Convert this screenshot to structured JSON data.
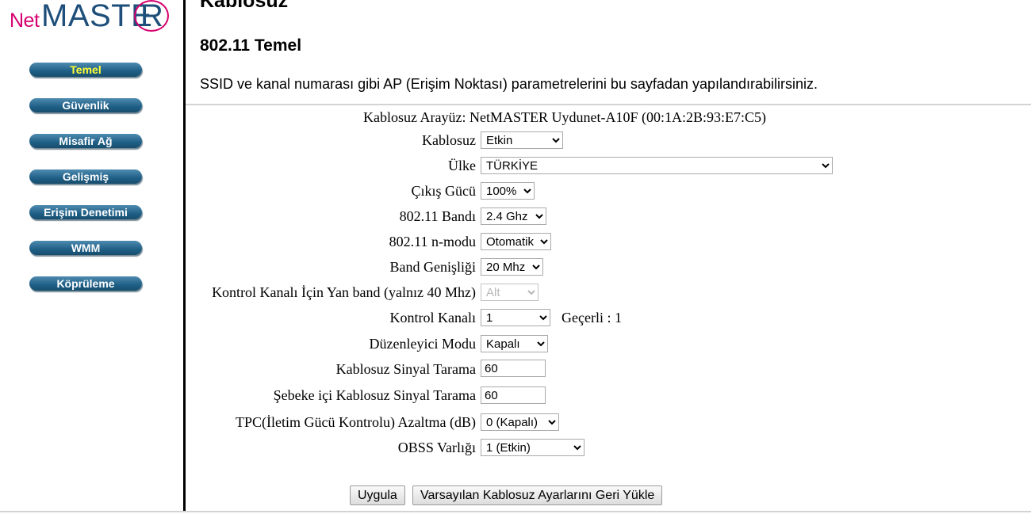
{
  "logo": {
    "text_net": "Net",
    "text_master": "MASTE",
    "text_r": "R"
  },
  "sidebar": {
    "items": [
      {
        "label": "Temel",
        "active": true
      },
      {
        "label": "Güvenlik"
      },
      {
        "label": "Misafir Ağ"
      },
      {
        "label": "Gelişmiş"
      },
      {
        "label": "Erişim Denetimi"
      },
      {
        "label": "WMM"
      },
      {
        "label": "Köprüleme"
      }
    ]
  },
  "main": {
    "page_title": "Kablosuz",
    "section_title": "802.11 Temel",
    "description": "SSID ve kanal numarası gibi AP (Erişim Noktası) parametrelerini bu sayfadan yapılandırabilirsiniz.",
    "interface": "Kablosuz Arayüz: NetMASTER Uydunet-A10F (00:1A:2B:93:E7:C5)"
  },
  "form": {
    "wireless": {
      "label": "Kablosuz",
      "value": "Etkin"
    },
    "country": {
      "label": "Ülke",
      "value": "TÜRKİYE"
    },
    "output_power": {
      "label": "Çıkış Gücü",
      "value": "100%"
    },
    "band": {
      "label": "802.11 Bandı",
      "value": "2.4 Ghz"
    },
    "n_mode": {
      "label": "802.11 n-modu",
      "value": "Otomatik"
    },
    "bandwidth": {
      "label": "Band Genişliği",
      "value": "20 Mhz"
    },
    "sideband": {
      "label": "Kontrol Kanalı İçin Yan band (yalnız 40 Mhz)",
      "value": "Alt"
    },
    "control_channel": {
      "label": "Kontrol Kanalı",
      "value": "1",
      "current": "Geçerli : 1"
    },
    "regulatory_mode": {
      "label": "Düzenleyici Modu",
      "value": "Kapalı"
    },
    "beacon": {
      "label": "Kablosuz Sinyal Tarama",
      "value": "60"
    },
    "intra_beacon": {
      "label": "Şebeke içi Kablosuz Sinyal Tarama",
      "value": "60"
    },
    "tpc": {
      "label": "TPC(İletim Gücü Kontrolu) Azaltma (dB)",
      "value": "0 (Kapalı)"
    },
    "obss": {
      "label": "OBSS Varlığı",
      "value": "1 (Etkin)"
    }
  },
  "buttons": {
    "apply": "Uygula",
    "restore": "Varsayılan Kablosuz Ayarlarını Geri Yükle"
  }
}
